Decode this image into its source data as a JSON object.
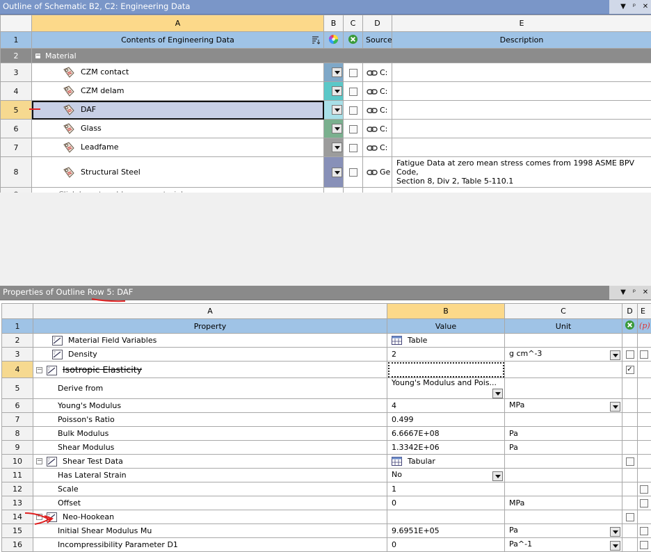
{
  "top": {
    "title": "Outline of Schematic B2, C2: Engineering Data",
    "cols": [
      "A",
      "B",
      "C",
      "D",
      "E"
    ],
    "header": {
      "contents": "Contents of Engineering Data",
      "source": "Source",
      "description": "Description"
    },
    "category": "Material",
    "rows": [
      {
        "num": "3",
        "name": "CZM contact",
        "color": "#7fa8c8",
        "source": "C:",
        "desc1": "",
        "desc2": ""
      },
      {
        "num": "4",
        "name": "CZM delam",
        "color": "#5bc8c8",
        "source": "C:",
        "desc1": "",
        "desc2": ""
      },
      {
        "num": "5",
        "name": "DAF",
        "color": "#a8e0e8",
        "source": "C:",
        "desc1": "",
        "desc2": ""
      },
      {
        "num": "6",
        "name": "Glass",
        "color": "#7ab08e",
        "source": "C:",
        "desc1": "",
        "desc2": ""
      },
      {
        "num": "7",
        "name": "Leadfame",
        "color": "#9c9c9c",
        "source": "C:",
        "desc1": "",
        "desc2": ""
      },
      {
        "num": "8",
        "name": "Structural Steel",
        "color": "#8890b8",
        "source": "Ge",
        "desc1": "Fatigue Data at zero mean stress comes from 1998 ASME BPV Code,",
        "desc2": "Section 8, Div 2, Table 5-110.1"
      }
    ],
    "add_row": {
      "num": "*",
      "text": "Click here to add a new material"
    },
    "row_nums": [
      "1",
      "2"
    ]
  },
  "props": {
    "title": "Properties of Outline Row 5: DAF",
    "cols": [
      "A",
      "B",
      "C",
      "D",
      "E"
    ],
    "header": {
      "num": "1",
      "property": "Property",
      "value": "Value",
      "unit": "Unit"
    },
    "rows": [
      {
        "num": "2",
        "name": "Material Field Variables",
        "value": "Table",
        "unit": ""
      },
      {
        "num": "3",
        "name": "Density",
        "value": "2",
        "unit": "g cm^-3"
      },
      {
        "num": "4",
        "name": "Isotropic Elasticity",
        "value": "",
        "unit": ""
      },
      {
        "num": "5",
        "name": "Derive from",
        "value": "Young's Modulus and Pois...",
        "unit": ""
      },
      {
        "num": "6",
        "name": "Young's Modulus",
        "value": "4",
        "unit": "MPa"
      },
      {
        "num": "7",
        "name": "Poisson's Ratio",
        "value": "0.499",
        "unit": ""
      },
      {
        "num": "8",
        "name": "Bulk Modulus",
        "value": "6.6667E+08",
        "unit": "Pa"
      },
      {
        "num": "9",
        "name": "Shear Modulus",
        "value": "1.3342E+06",
        "unit": "Pa"
      },
      {
        "num": "10",
        "name": "Shear Test Data",
        "value": "Tabular",
        "unit": ""
      },
      {
        "num": "11",
        "name": "Has Lateral Strain",
        "value": "No",
        "unit": ""
      },
      {
        "num": "12",
        "name": "Scale",
        "value": "1",
        "unit": ""
      },
      {
        "num": "13",
        "name": "Offset",
        "value": "0",
        "unit": "MPa"
      },
      {
        "num": "14",
        "name": "Neo-Hookean",
        "value": "",
        "unit": ""
      },
      {
        "num": "15",
        "name": "Initial Shear Modulus Mu",
        "value": "9.6951E+05",
        "unit": "Pa"
      },
      {
        "num": "16",
        "name": "Incompressibility Parameter D1",
        "value": "0",
        "unit": "Pa^-1"
      }
    ]
  },
  "annotation_color": "#e02020"
}
